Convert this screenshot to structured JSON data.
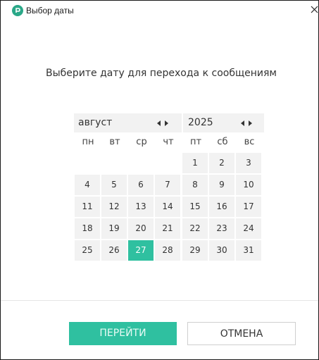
{
  "window": {
    "title": "Выбор даты",
    "close_glyph": "×",
    "accent_color": "#2fc0a0"
  },
  "icons": {
    "app": "app-logo-icon",
    "close": "close-icon"
  },
  "prompt": "Выберите дату для перехода к сообщениям",
  "calendar": {
    "month": "август",
    "year": "2025",
    "weekdays": [
      "пн",
      "вт",
      "ср",
      "чт",
      "пт",
      "сб",
      "вс"
    ],
    "selected_day": "27",
    "days": [
      "1",
      "2",
      "3",
      "4",
      "5",
      "6",
      "7",
      "8",
      "9",
      "10",
      "11",
      "12",
      "13",
      "14",
      "15",
      "16",
      "17",
      "18",
      "19",
      "20",
      "21",
      "22",
      "23",
      "24",
      "25",
      "26",
      "27",
      "28",
      "29",
      "30",
      "31"
    ]
  },
  "buttons": {
    "go": "ПЕРЕЙТИ",
    "cancel": "ОТМЕНА"
  }
}
